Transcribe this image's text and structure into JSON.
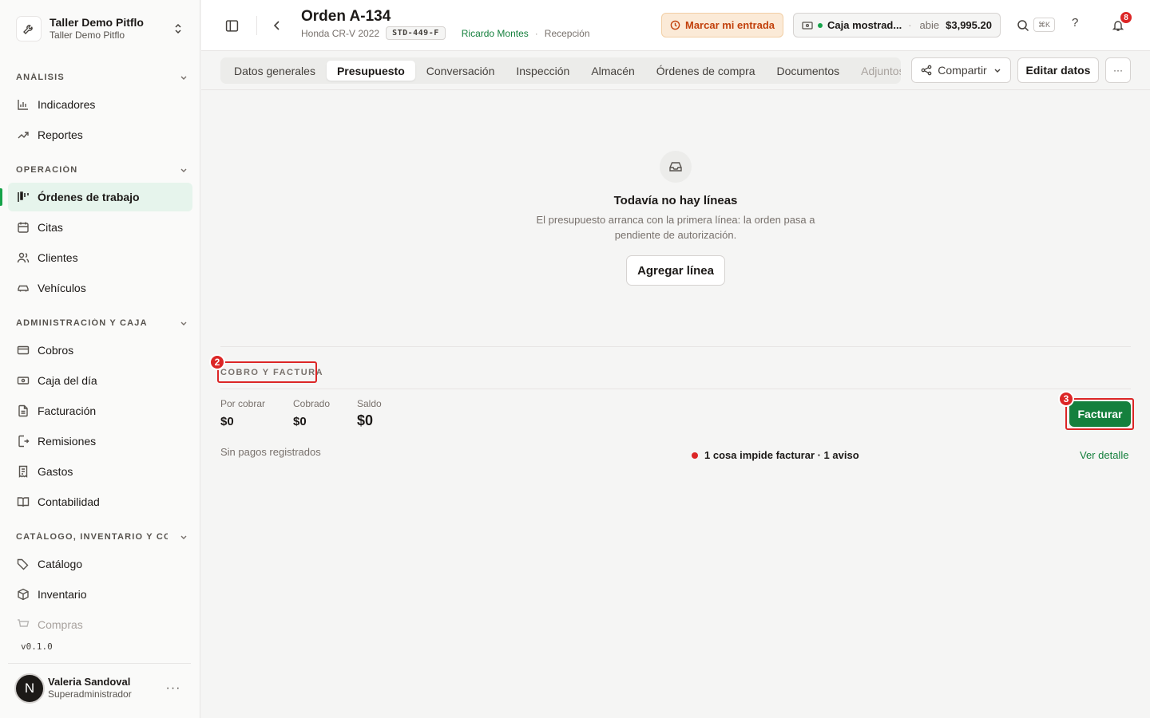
{
  "sidebar": {
    "brand": {
      "name": "Taller Demo Pitflo",
      "subtitle": "Taller Demo Pitflo"
    },
    "sections": [
      {
        "title": "ANÁLISIS",
        "items": [
          {
            "label": "Indicadores",
            "icon": "bar-chart-icon"
          },
          {
            "label": "Reportes",
            "icon": "trend-up-icon"
          }
        ]
      },
      {
        "title": "OPERACIÓN",
        "items": [
          {
            "label": "Órdenes de trabajo",
            "icon": "kanban-icon",
            "active": true
          },
          {
            "label": "Citas",
            "icon": "calendar-icon"
          },
          {
            "label": "Clientes",
            "icon": "users-icon"
          },
          {
            "label": "Vehículos",
            "icon": "car-icon"
          }
        ]
      },
      {
        "title": "ADMINISTRACIÓN Y CAJA",
        "items": [
          {
            "label": "Cobros",
            "icon": "credit-card-icon"
          },
          {
            "label": "Caja del día",
            "icon": "banknote-icon"
          },
          {
            "label": "Facturación",
            "icon": "file-text-icon"
          },
          {
            "label": "Remisiones",
            "icon": "file-export-icon"
          },
          {
            "label": "Gastos",
            "icon": "receipt-icon"
          },
          {
            "label": "Contabilidad",
            "icon": "book-icon"
          }
        ]
      },
      {
        "title": "CATÁLOGO, INVENTARIO Y CO...",
        "items": [
          {
            "label": "Catálogo",
            "icon": "tags-icon"
          },
          {
            "label": "Inventario",
            "icon": "package-icon"
          },
          {
            "label": "Compras",
            "icon": "cart-icon"
          }
        ]
      }
    ],
    "version": "v0.1.0",
    "user": {
      "initial": "N",
      "name": "Valeria Sandoval",
      "role": "Superadministrador",
      "more": "···"
    }
  },
  "header": {
    "title": "Orden A-134",
    "vehicle": "Honda CR-V 2022",
    "plate": "STD-449-F",
    "customer": "Ricardo Montes",
    "separator": "·",
    "stage": "Recepción",
    "checkin_label": "Marcar mi entrada",
    "cash": {
      "name": "Caja mostrad...",
      "separator": "·",
      "state": "abie",
      "amount": "$3,995.20"
    },
    "search_shortcut": "⌘K",
    "help": "?",
    "notifications": "8"
  },
  "tabs": [
    "Datos generales",
    "Presupuesto",
    "Conversación",
    "Inspección",
    "Almacén",
    "Órdenes de compra",
    "Documentos",
    "Adjuntos"
  ],
  "actions": {
    "share": "Compartir",
    "edit": "Editar datos",
    "more": "···"
  },
  "empty": {
    "title": "Todavía no hay líneas",
    "description": "El presupuesto arranca con la primera línea: la orden pasa a pendiente de autorización.",
    "add_line": "Agregar línea"
  },
  "billing": {
    "section_title": "COBRO Y FACTURA",
    "stats": [
      {
        "label": "Por cobrar",
        "value": "$0"
      },
      {
        "label": "Cobrado",
        "value": "$0"
      },
      {
        "label": "Saldo",
        "value": "$0"
      }
    ],
    "no_payments": "Sin pagos registrados",
    "blocker": "1 cosa impide facturar · 1 aviso",
    "detail_link": "Ver detalle",
    "invoice": "Facturar"
  },
  "markers": [
    "2",
    "3"
  ],
  "colors": {
    "accent": "#15803d",
    "active_bg": "#e6f4ec",
    "danger": "#dc2626",
    "warning_bg": "#fbead7"
  }
}
